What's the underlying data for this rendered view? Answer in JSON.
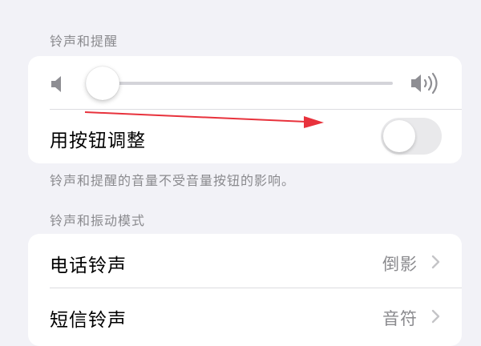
{
  "ringer": {
    "header": "铃声和提醒",
    "volume_level": 0.0,
    "adjust_label": "用按钮调整",
    "adjust_enabled": false,
    "footer": "铃声和提醒的音量不受音量按钮的影响。"
  },
  "patterns": {
    "header": "铃声和振动模式",
    "rows": [
      {
        "label": "电话铃声",
        "value": "倒影"
      },
      {
        "label": "短信铃声",
        "value": "音符"
      }
    ]
  },
  "icons": {
    "volume_low": "speaker-low-icon",
    "volume_high": "speaker-high-icon",
    "chevron": "chevron-right-icon"
  },
  "colors": {
    "accent": "#0a84ff",
    "annotation_arrow": "#e8323c",
    "secondary_text": "#8a8a8e",
    "background": "#f2f2f7"
  }
}
